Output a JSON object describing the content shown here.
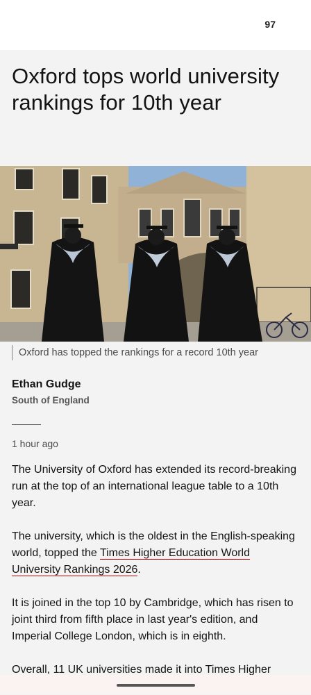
{
  "status": {
    "battery": "97"
  },
  "article": {
    "headline": "Oxford tops world university rankings for 10th year",
    "image_caption": "Oxford has topped the rankings for a record 10th year",
    "author": {
      "name": "Ethan Gudge",
      "region": "South of England"
    },
    "timestamp": "1 hour ago",
    "paragraphs": {
      "p1": "The University of Oxford has extended its record-breaking run at the top of an international league table to a 10th year.",
      "p2_before": "The university, which is the oldest in the English-speaking world, topped the ",
      "p2_link": "Times Higher Education World University Rankings 2026",
      "p2_after": ".",
      "p3": "It is joined in the top 10 by Cambridge, which has risen to joint third from fifth place in last year's edition, and Imperial College London, which is in eighth.",
      "p4": "Overall, 11 UK universities made it into Times Higher"
    }
  },
  "colors": {
    "background": "#f3f3f3",
    "link_underline": "#b80000",
    "text": "#141414"
  }
}
